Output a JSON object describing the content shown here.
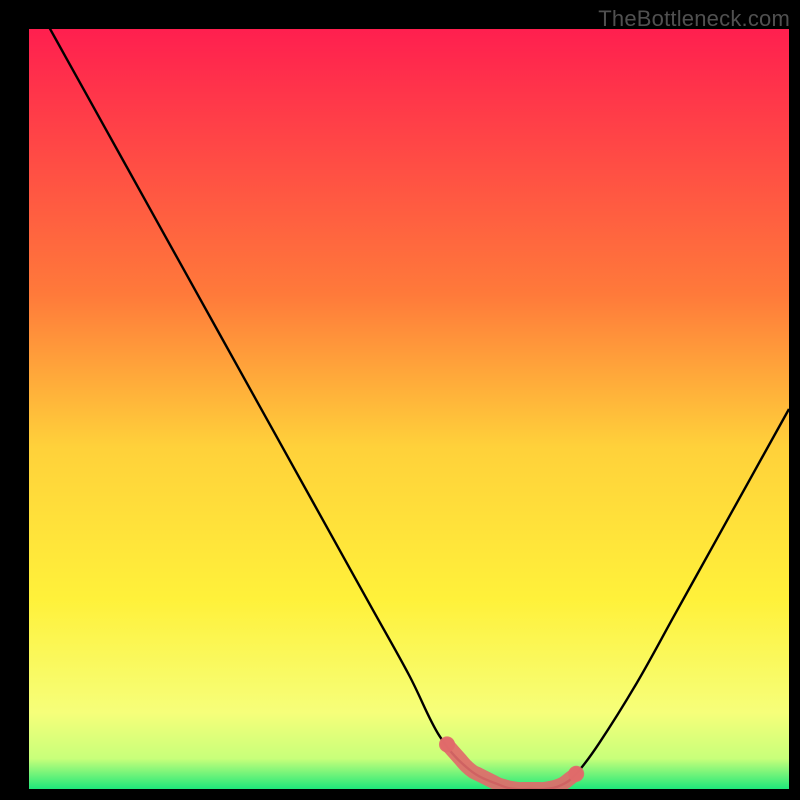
{
  "watermark": "TheBottleneck.com",
  "chart_data": {
    "type": "line",
    "title": "",
    "xlabel": "",
    "ylabel": "",
    "xlim": [
      0,
      100
    ],
    "ylim": [
      0,
      100
    ],
    "series": [
      {
        "name": "curve",
        "x": [
          0,
          5,
          10,
          15,
          20,
          25,
          30,
          35,
          40,
          45,
          50,
          54,
          58,
          62,
          64,
          66,
          68,
          70,
          72,
          75,
          80,
          85,
          90,
          95,
          100
        ],
        "y": [
          105,
          96,
          87,
          78,
          69,
          60,
          51,
          42,
          33,
          24,
          15,
          7,
          2.5,
          0.5,
          0,
          0,
          0,
          0.5,
          2,
          6,
          14,
          23,
          32,
          41,
          50
        ]
      }
    ],
    "optimal_band": {
      "x_start": 55,
      "x_end": 72,
      "y": 0,
      "color": "#e16a6a"
    },
    "gradient_stops": [
      {
        "offset": 0,
        "color": "#ff1f4f"
      },
      {
        "offset": 35,
        "color": "#ff7a3a"
      },
      {
        "offset": 55,
        "color": "#ffd13a"
      },
      {
        "offset": 75,
        "color": "#fff13a"
      },
      {
        "offset": 90,
        "color": "#f6ff7a"
      },
      {
        "offset": 96,
        "color": "#c8ff7a"
      },
      {
        "offset": 100,
        "color": "#1ee87a"
      }
    ]
  }
}
